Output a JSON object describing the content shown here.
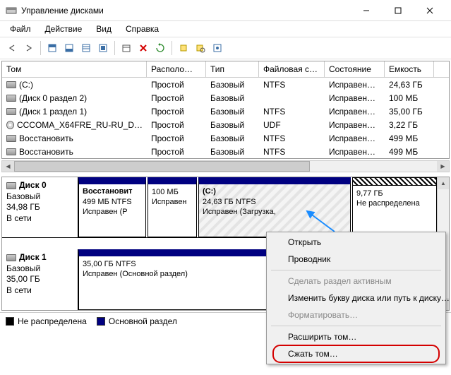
{
  "window": {
    "title": "Управление дисками"
  },
  "menubar": {
    "file": "Файл",
    "action": "Действие",
    "view": "Вид",
    "help": "Справка"
  },
  "columns": {
    "vol": "Том",
    "layout": "Располо…",
    "type": "Тип",
    "fs": "Файловая с…",
    "status": "Состояние",
    "cap": "Емкость"
  },
  "volumes": [
    {
      "icon": "hdd",
      "name": "(C:)",
      "layout": "Простой",
      "type": "Базовый",
      "fs": "NTFS",
      "status": "Исправен…",
      "cap": "24,63 ГБ"
    },
    {
      "icon": "hdd",
      "name": "(Диск 0 раздел 2)",
      "layout": "Простой",
      "type": "Базовый",
      "fs": "",
      "status": "Исправен…",
      "cap": "100 МБ"
    },
    {
      "icon": "hdd",
      "name": "(Диск 1 раздел 1)",
      "layout": "Простой",
      "type": "Базовый",
      "fs": "NTFS",
      "status": "Исправен…",
      "cap": "35,00 ГБ"
    },
    {
      "icon": "cd",
      "name": "CCCOMA_X64FRE_RU-RU_D…",
      "layout": "Простой",
      "type": "Базовый",
      "fs": "UDF",
      "status": "Исправен…",
      "cap": "3,22 ГБ"
    },
    {
      "icon": "hdd",
      "name": "Восстановить",
      "layout": "Простой",
      "type": "Базовый",
      "fs": "NTFS",
      "status": "Исправен…",
      "cap": "499 МБ"
    },
    {
      "icon": "hdd",
      "name": "Восстановить",
      "layout": "Простой",
      "type": "Базовый",
      "fs": "NTFS",
      "status": "Исправен…",
      "cap": "499 МБ"
    }
  ],
  "diskmap": {
    "disk0": {
      "name": "Диск 0",
      "type": "Базовый",
      "size": "34,98 ГБ",
      "status": "В сети",
      "parts": {
        "p1": {
          "title": "Восстановит",
          "line2": "499 МБ NTFS",
          "line3": "Исправен (Р"
        },
        "p2": {
          "title": "",
          "line2": "100 МБ",
          "line3": "Исправен"
        },
        "p3": {
          "title": "(C:)",
          "line2": "24,63 ГБ NTFS",
          "line3": "Исправен (Загрузка,"
        },
        "p4": {
          "title": "",
          "line2": "9,77 ГБ",
          "line3": "Не распределена"
        }
      }
    },
    "disk1": {
      "name": "Диск 1",
      "type": "Базовый",
      "size": "35,00 ГБ",
      "status": "В сети",
      "part": {
        "title": "",
        "line2": "35,00 ГБ NTFS",
        "line3": "Исправен (Основной раздел)"
      }
    }
  },
  "legend": {
    "unallocated": "Не распределена",
    "primary": "Основной раздел"
  },
  "context_menu": {
    "open": "Открыть",
    "explorer": "Проводник",
    "active": "Сделать раздел активным",
    "change_letter": "Изменить букву диска или путь к диску…",
    "format": "Форматировать…",
    "extend": "Расширить том…",
    "shrink": "Сжать том…"
  },
  "colors": {
    "navy": "#000080",
    "highlight_red": "#d40000",
    "arrow_blue": "#1a8cff"
  }
}
